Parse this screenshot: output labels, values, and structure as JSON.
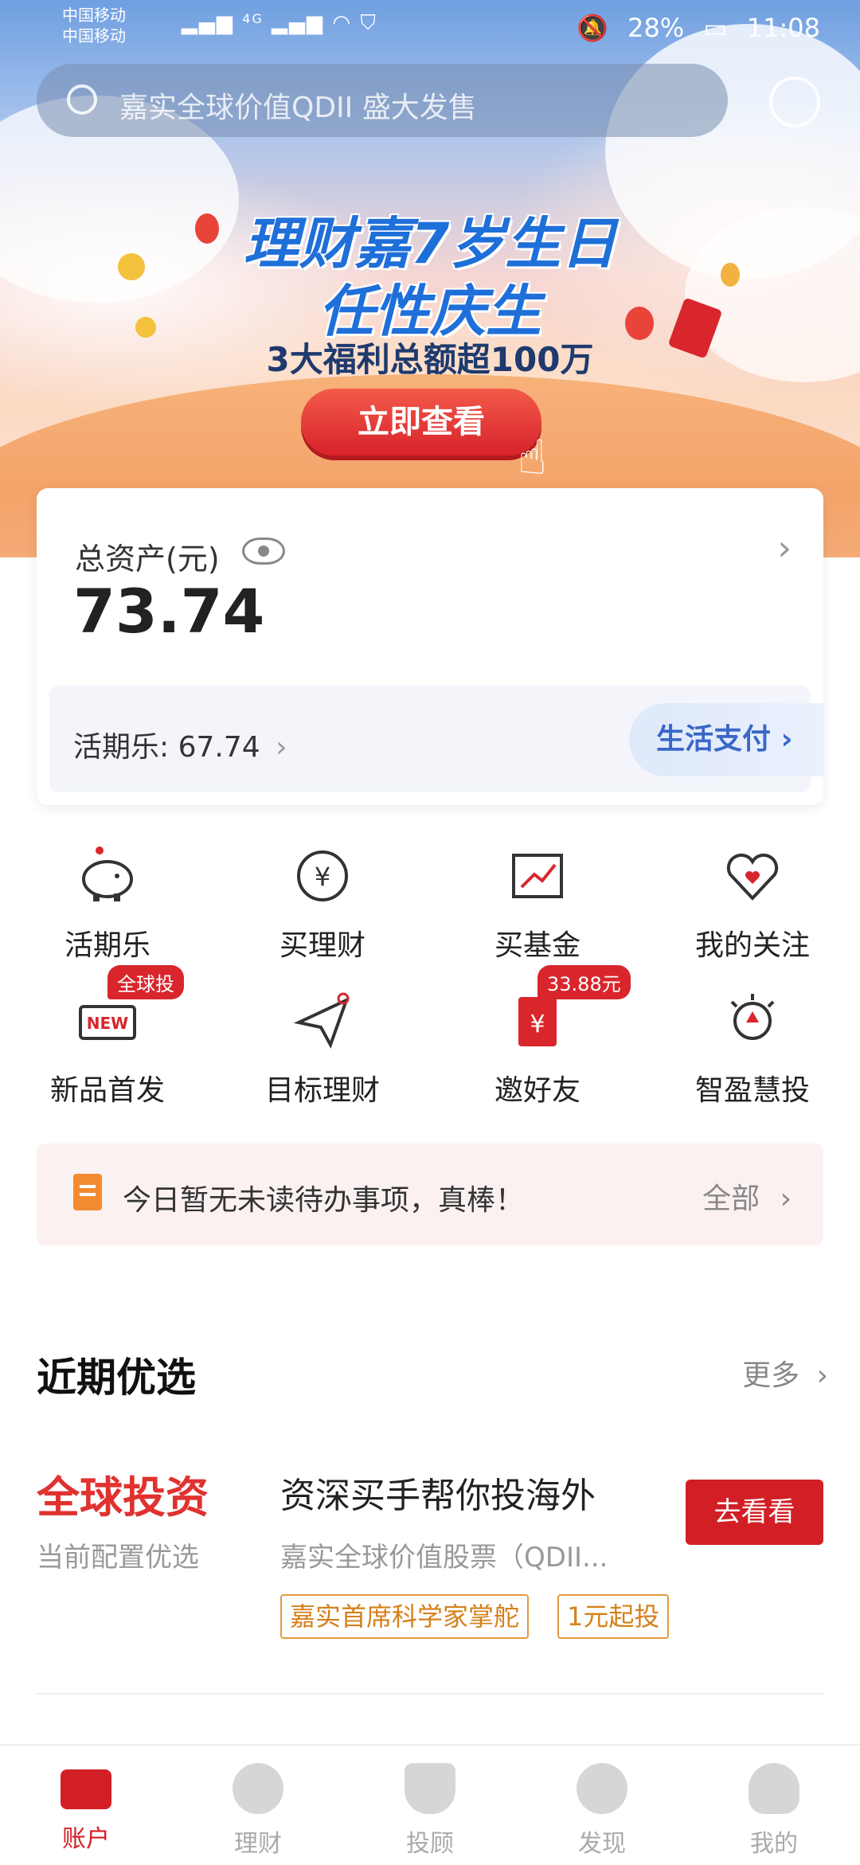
{
  "status_bar": {
    "carrier_1": "中国移动",
    "carrier_2": "中国移动",
    "network": "4G",
    "battery": "28%",
    "time": "11:08"
  },
  "search": {
    "placeholder": "嘉实全球价值QDII 盛大发售"
  },
  "banner": {
    "title_line1": "理财嘉7岁生日",
    "title_line2": "任性庆生",
    "subtitle": "3大福利总额超100万",
    "cta": "立即查看"
  },
  "asset_card": {
    "label": "总资产(元)",
    "value": "73.74",
    "huoqile": "活期乐: 67.74",
    "life_pay": "生活支付"
  },
  "quick_grid": [
    {
      "label": "活期乐",
      "icon": "piggy-bank-icon"
    },
    {
      "label": "买理财",
      "icon": "yuan-coin-icon"
    },
    {
      "label": "买基金",
      "icon": "trend-chart-icon"
    },
    {
      "label": "我的关注",
      "icon": "heart-icon"
    },
    {
      "label": "新品首发",
      "icon": "new-tag-icon",
      "badge": "全球投"
    },
    {
      "label": "目标理财",
      "icon": "paper-plane-icon"
    },
    {
      "label": "邀好友",
      "icon": "red-envelope-icon",
      "badge": "33.88元"
    },
    {
      "label": "智盈慧投",
      "icon": "lightbulb-icon"
    }
  ],
  "todo": {
    "text": "今日暂无未读待办事项，真棒！",
    "all": "全部"
  },
  "recent": {
    "title": "近期优选",
    "more": "更多",
    "tag": "全球投资",
    "tag_sub": "当前配置优选",
    "product_title": "资深买手帮你投海外",
    "product_sub": "嘉实全球价值股票（QDII...",
    "chips": [
      "嘉实首席科学家掌舵",
      "1元起投"
    ],
    "button": "去看看"
  },
  "tabs": [
    {
      "label": "账户",
      "active": true
    },
    {
      "label": "理财",
      "active": false
    },
    {
      "label": "投顾",
      "active": false
    },
    {
      "label": "发现",
      "active": false
    },
    {
      "label": "我的",
      "active": false
    }
  ],
  "colors": {
    "accent_red": "#d21f26",
    "banner_blue": "#1f6fd9",
    "life_pay_blue": "#3a67c7"
  }
}
